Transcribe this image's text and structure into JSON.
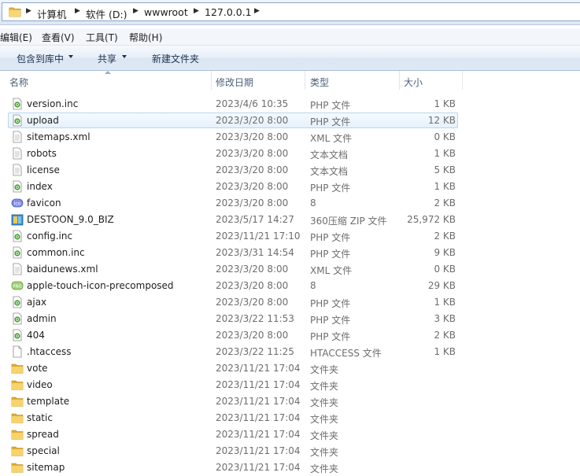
{
  "address": {
    "crumbs": [
      "计算机",
      "软件 (D:)",
      "wwwroot",
      "127.0.0.1"
    ]
  },
  "menu": [
    "编辑(E)",
    "查看(V)",
    "工具(T)",
    "帮助(H)"
  ],
  "toolbar": {
    "include_label": "包含到库中",
    "share_label": "共享",
    "new_folder_label": "新建文件夹"
  },
  "columns": {
    "name": "名称",
    "date": "修改日期",
    "type": "类型",
    "size": "大小"
  },
  "files": [
    {
      "name": "version.inc",
      "date": "2023/4/6 10:35",
      "type": "PHP 文件",
      "size": "1 KB",
      "icon": "php-file-icon"
    },
    {
      "name": "upload",
      "date": "2023/3/20 8:00",
      "type": "PHP 文件",
      "size": "12 KB",
      "icon": "php-file-icon"
    },
    {
      "name": "sitemaps.xml",
      "date": "2023/3/20 8:00",
      "type": "XML 文件",
      "size": "0 KB",
      "icon": "text-file-icon"
    },
    {
      "name": "robots",
      "date": "2023/3/20 8:00",
      "type": "文本文档",
      "size": "1 KB",
      "icon": "text-file-icon"
    },
    {
      "name": "license",
      "date": "2023/3/20 8:00",
      "type": "文本文档",
      "size": "5 KB",
      "icon": "text-file-icon"
    },
    {
      "name": "index",
      "date": "2023/3/20 8:00",
      "type": "PHP 文件",
      "size": "1 KB",
      "icon": "php-file-icon"
    },
    {
      "name": "favicon",
      "date": "2023/3/20 8:00",
      "type": "8",
      "size": "2 KB",
      "icon": "ico-file-icon"
    },
    {
      "name": "DESTOON_9.0_BIZ",
      "date": "2023/5/17 14:27",
      "type": "360压缩 ZIP 文件",
      "size": "25,972 KB",
      "icon": "zip-file-icon"
    },
    {
      "name": "config.inc",
      "date": "2023/11/21 17:10",
      "type": "PHP 文件",
      "size": "2 KB",
      "icon": "php-file-icon"
    },
    {
      "name": "common.inc",
      "date": "2023/3/31 14:54",
      "type": "PHP 文件",
      "size": "9 KB",
      "icon": "php-file-icon"
    },
    {
      "name": "baidunews.xml",
      "date": "2023/3/20 8:00",
      "type": "XML 文件",
      "size": "0 KB",
      "icon": "text-file-icon"
    },
    {
      "name": "apple-touch-icon-precomposed",
      "date": "2023/3/20 8:00",
      "type": "8",
      "size": "29 KB",
      "icon": "png-file-icon"
    },
    {
      "name": "ajax",
      "date": "2023/3/20 8:00",
      "type": "PHP 文件",
      "size": "1 KB",
      "icon": "php-file-icon"
    },
    {
      "name": "admin",
      "date": "2023/3/22 11:53",
      "type": "PHP 文件",
      "size": "3 KB",
      "icon": "php-file-icon"
    },
    {
      "name": "404",
      "date": "2023/3/20 8:00",
      "type": "PHP 文件",
      "size": "2 KB",
      "icon": "php-file-icon"
    },
    {
      "name": ".htaccess",
      "date": "2023/3/22 11:25",
      "type": "HTACCESS 文件",
      "size": "1 KB",
      "icon": "blank-file-icon"
    },
    {
      "name": "vote",
      "date": "2023/11/21 17:04",
      "type": "文件夹",
      "size": "",
      "icon": "folder-icon"
    },
    {
      "name": "video",
      "date": "2023/11/21 17:04",
      "type": "文件夹",
      "size": "",
      "icon": "folder-icon"
    },
    {
      "name": "template",
      "date": "2023/11/21 17:04",
      "type": "文件夹",
      "size": "",
      "icon": "folder-icon"
    },
    {
      "name": "static",
      "date": "2023/11/21 17:04",
      "type": "文件夹",
      "size": "",
      "icon": "folder-icon"
    },
    {
      "name": "spread",
      "date": "2023/11/21 17:04",
      "type": "文件夹",
      "size": "",
      "icon": "folder-icon"
    },
    {
      "name": "special",
      "date": "2023/11/21 17:04",
      "type": "文件夹",
      "size": "",
      "icon": "folder-icon"
    },
    {
      "name": "sitemap",
      "date": "2023/11/21 17:04",
      "type": "文件夹",
      "size": "",
      "icon": "folder-icon"
    }
  ],
  "hovered_row": 1
}
